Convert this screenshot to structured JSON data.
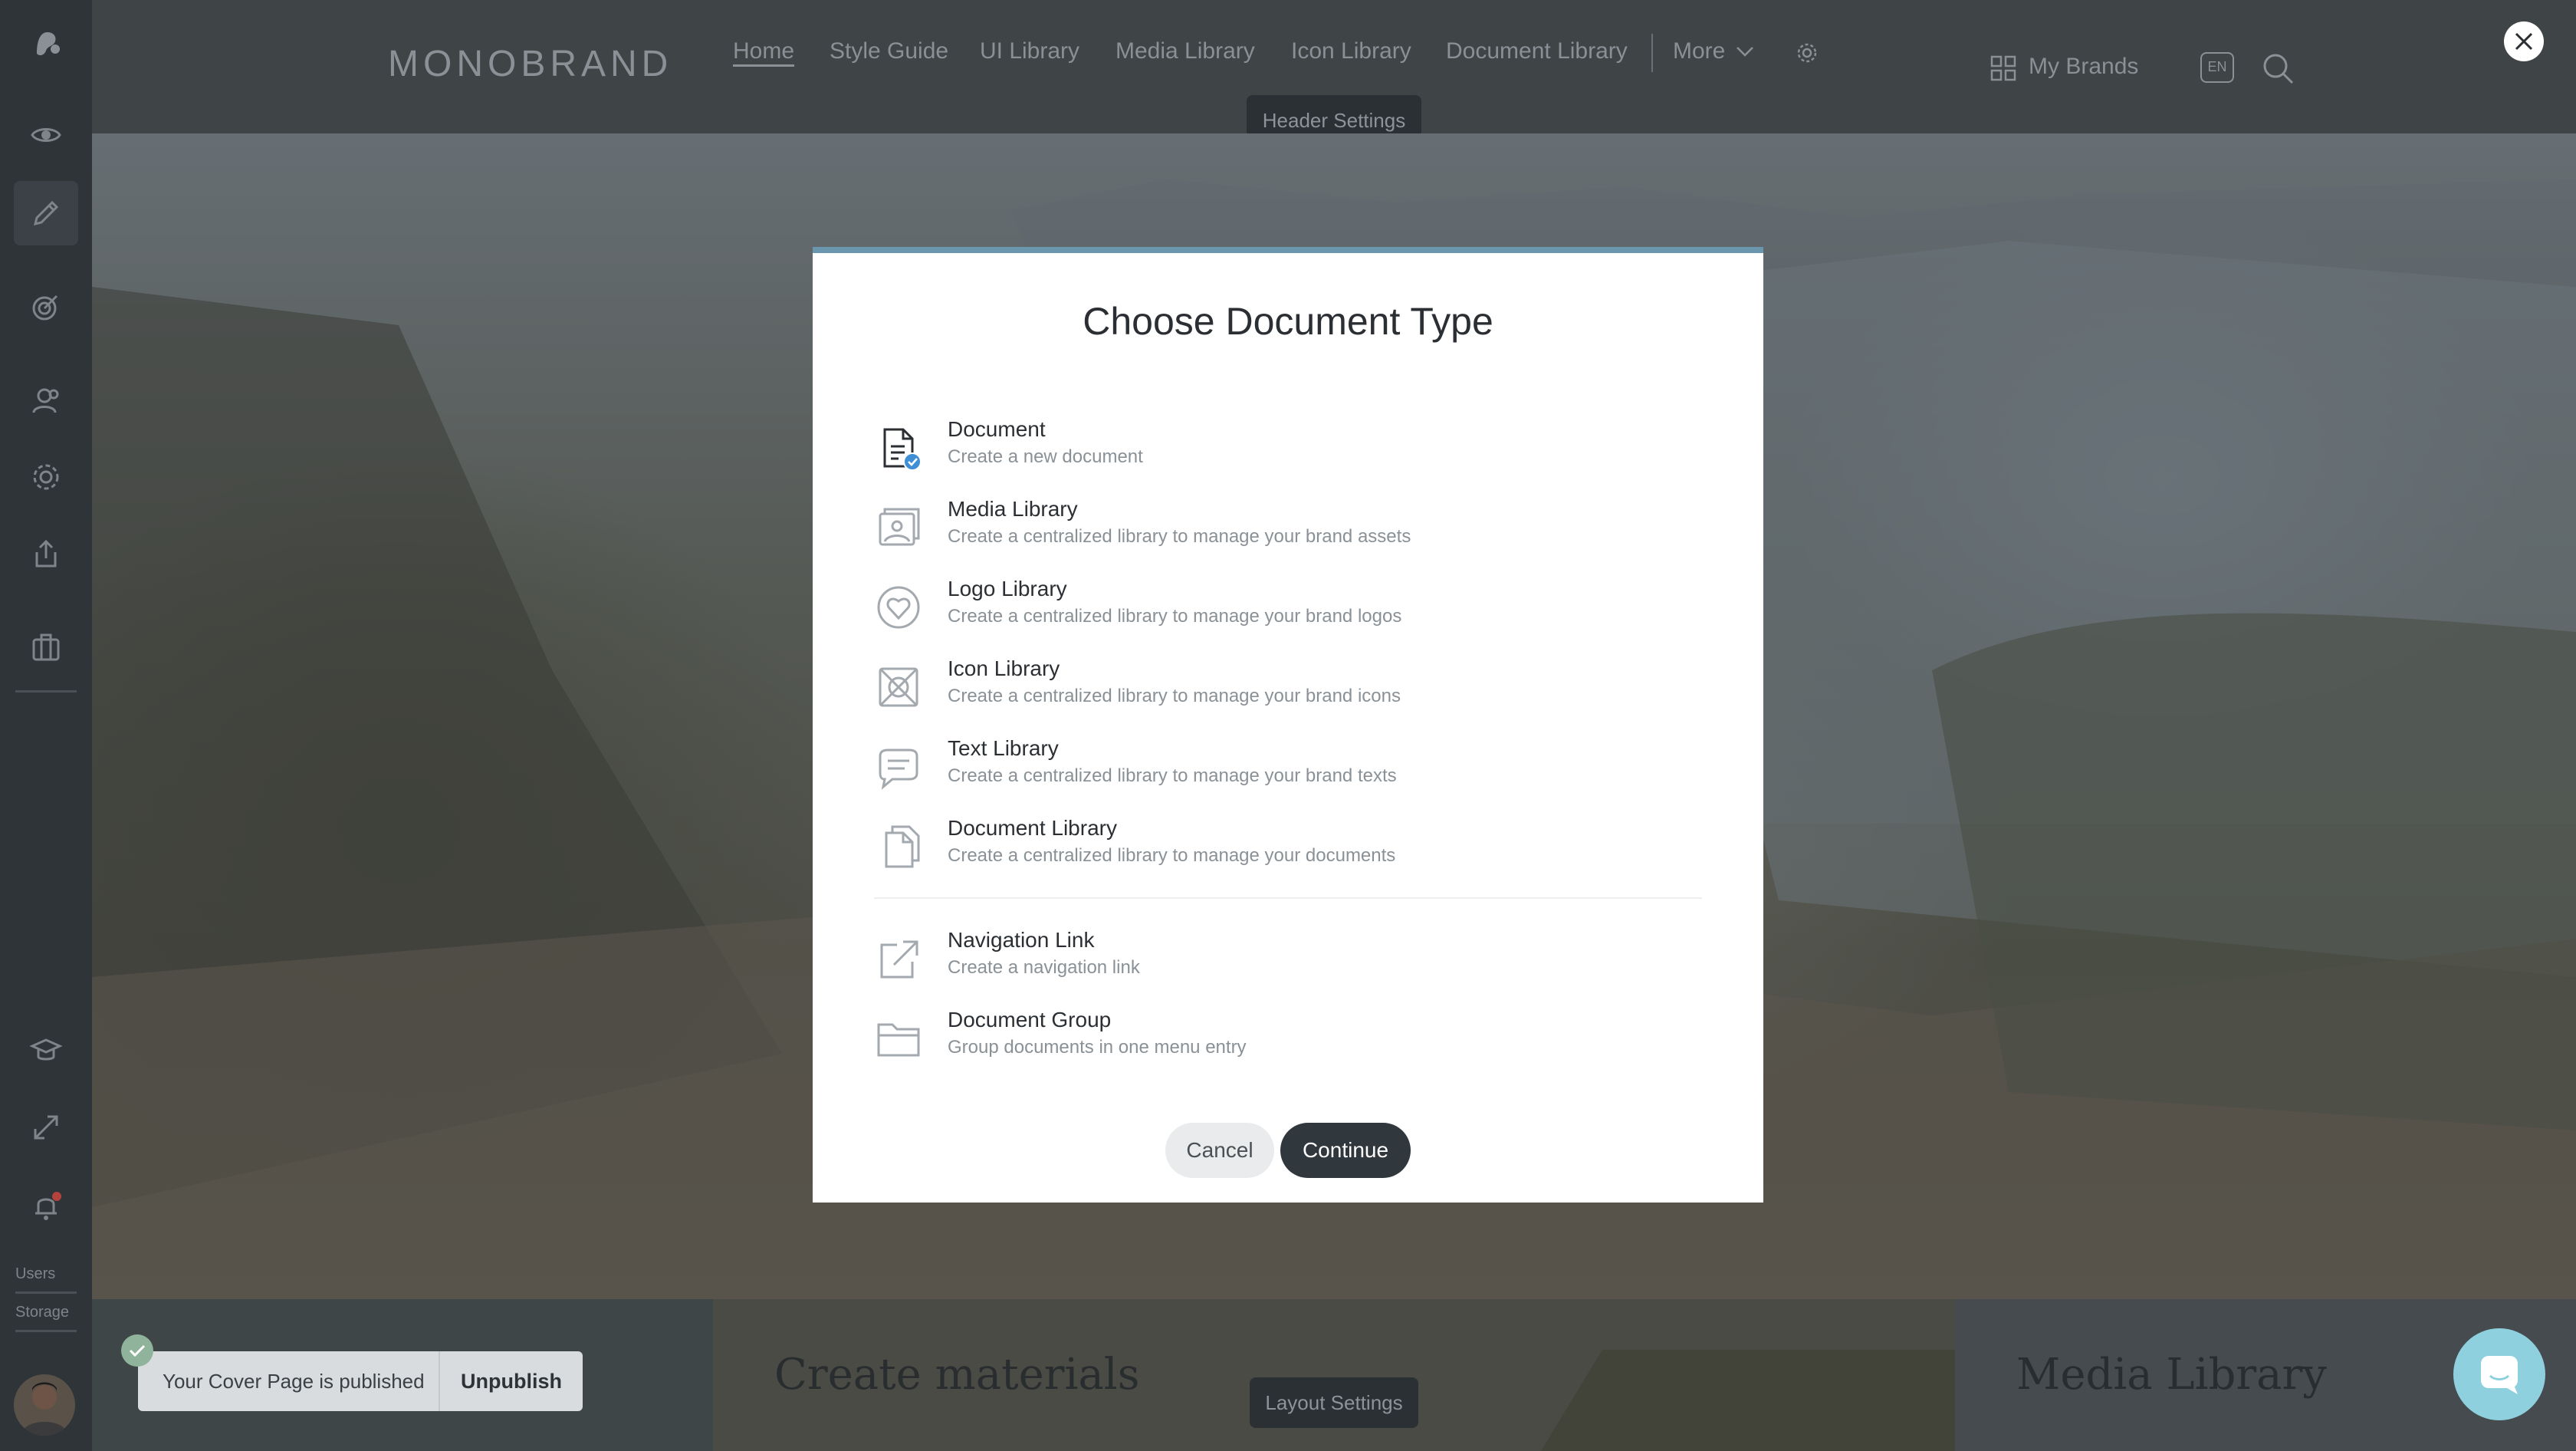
{
  "header": {
    "logo": "MONOBRAND",
    "nav": [
      "Home",
      "Style Guide",
      "UI Library",
      "Media Library",
      "Icon Library",
      "Document Library"
    ],
    "more_label": "More",
    "header_settings_tooltip": "Header Settings",
    "my_brands": "My Brands",
    "language_badge": "EN"
  },
  "sidebar": {
    "users_label": "Users",
    "storage_label": "Storage"
  },
  "modal": {
    "title": "Choose Document Type",
    "options": [
      {
        "title": "Document",
        "desc": "Create a new document",
        "icon": "document-icon"
      },
      {
        "title": "Media Library",
        "desc": "Create a centralized library to manage your brand assets",
        "icon": "media-library-icon"
      },
      {
        "title": "Logo Library",
        "desc": "Create a centralized library to manage your brand logos",
        "icon": "logo-library-icon"
      },
      {
        "title": "Icon Library",
        "desc": "Create a centralized library to manage your brand icons",
        "icon": "icon-library-icon"
      },
      {
        "title": "Text Library",
        "desc": "Create a centralized library to manage your brand texts",
        "icon": "text-library-icon"
      },
      {
        "title": "Document Library",
        "desc": "Create a centralized library to manage your documents",
        "icon": "document-library-icon"
      },
      {
        "title": "Navigation Link",
        "desc": "Create a navigation link",
        "icon": "external-link-icon"
      },
      {
        "title": "Document Group",
        "desc": "Group documents in one menu entry",
        "icon": "folder-icon"
      }
    ],
    "cancel_label": "Cancel",
    "continue_label": "Continue"
  },
  "bottom": {
    "tile_create": "Create materials",
    "layout_settings": "Layout Settings",
    "tile_media": "Media Library"
  },
  "toast": {
    "message": "Your Cover Page is published",
    "action": "Unpublish"
  },
  "colors": {
    "modal_accent": "#6a97ad",
    "primary_button": "#30373d",
    "chat_bubble": "#8ed0de",
    "selected_check": "#3f8fd6"
  }
}
